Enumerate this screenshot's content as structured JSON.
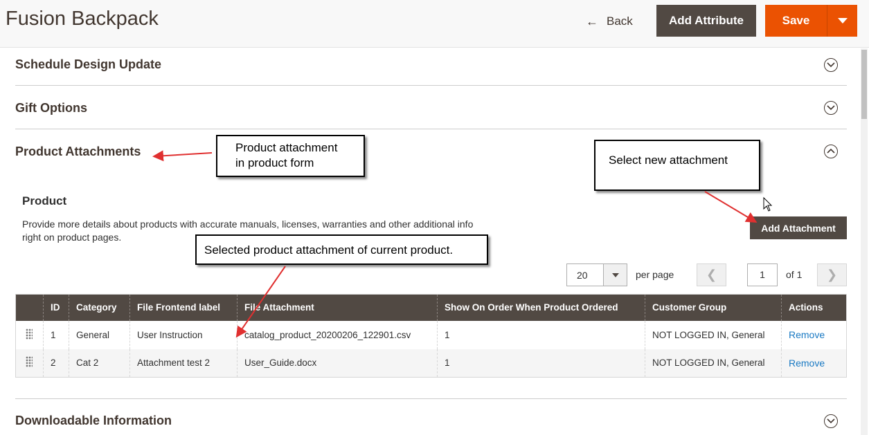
{
  "header": {
    "title": "Fusion Backpack",
    "back_label": "Back",
    "add_attribute_label": "Add Attribute",
    "save_label": "Save"
  },
  "sections": {
    "schedule": "Schedule Design Update",
    "gift": "Gift Options",
    "attachments": "Product Attachments",
    "downloadable": "Downloadable Information"
  },
  "product": {
    "title": "Product",
    "description_line1": "Provide more details about products with accurate manuals, licenses, warranties and other additional info",
    "description_line2": "right on product pages.",
    "add_attachment_label": "Add Attachment"
  },
  "pager": {
    "per_page_value": "20",
    "per_page_label": "per page",
    "page": "1",
    "of_label": "of 1"
  },
  "table": {
    "headers": [
      "",
      "ID",
      "Category",
      "File Frontend label",
      "File Attachment",
      "Show On Order When Product Ordered",
      "Customer Group",
      "Actions"
    ],
    "rows": [
      {
        "id": "1",
        "category": "General",
        "label": "User Instruction",
        "file": "catalog_product_20200206_122901.csv",
        "show": "1",
        "group": "NOT LOGGED IN, General",
        "action": "Remove"
      },
      {
        "id": "2",
        "category": "Cat 2",
        "label": "Attachment test 2",
        "file": "User_Guide.docx",
        "show": "1",
        "group": "NOT LOGGED IN, General",
        "action": "Remove"
      }
    ]
  },
  "annotations": {
    "note1_line1": "Product attachment",
    "note1_line2": "in product form",
    "note2": "Select new attachment",
    "note3": "Selected product attachment of current product."
  },
  "colors": {
    "primary": "#eb5202",
    "secondary": "#514943",
    "link": "#1979c3",
    "arrow": "#e03030"
  }
}
